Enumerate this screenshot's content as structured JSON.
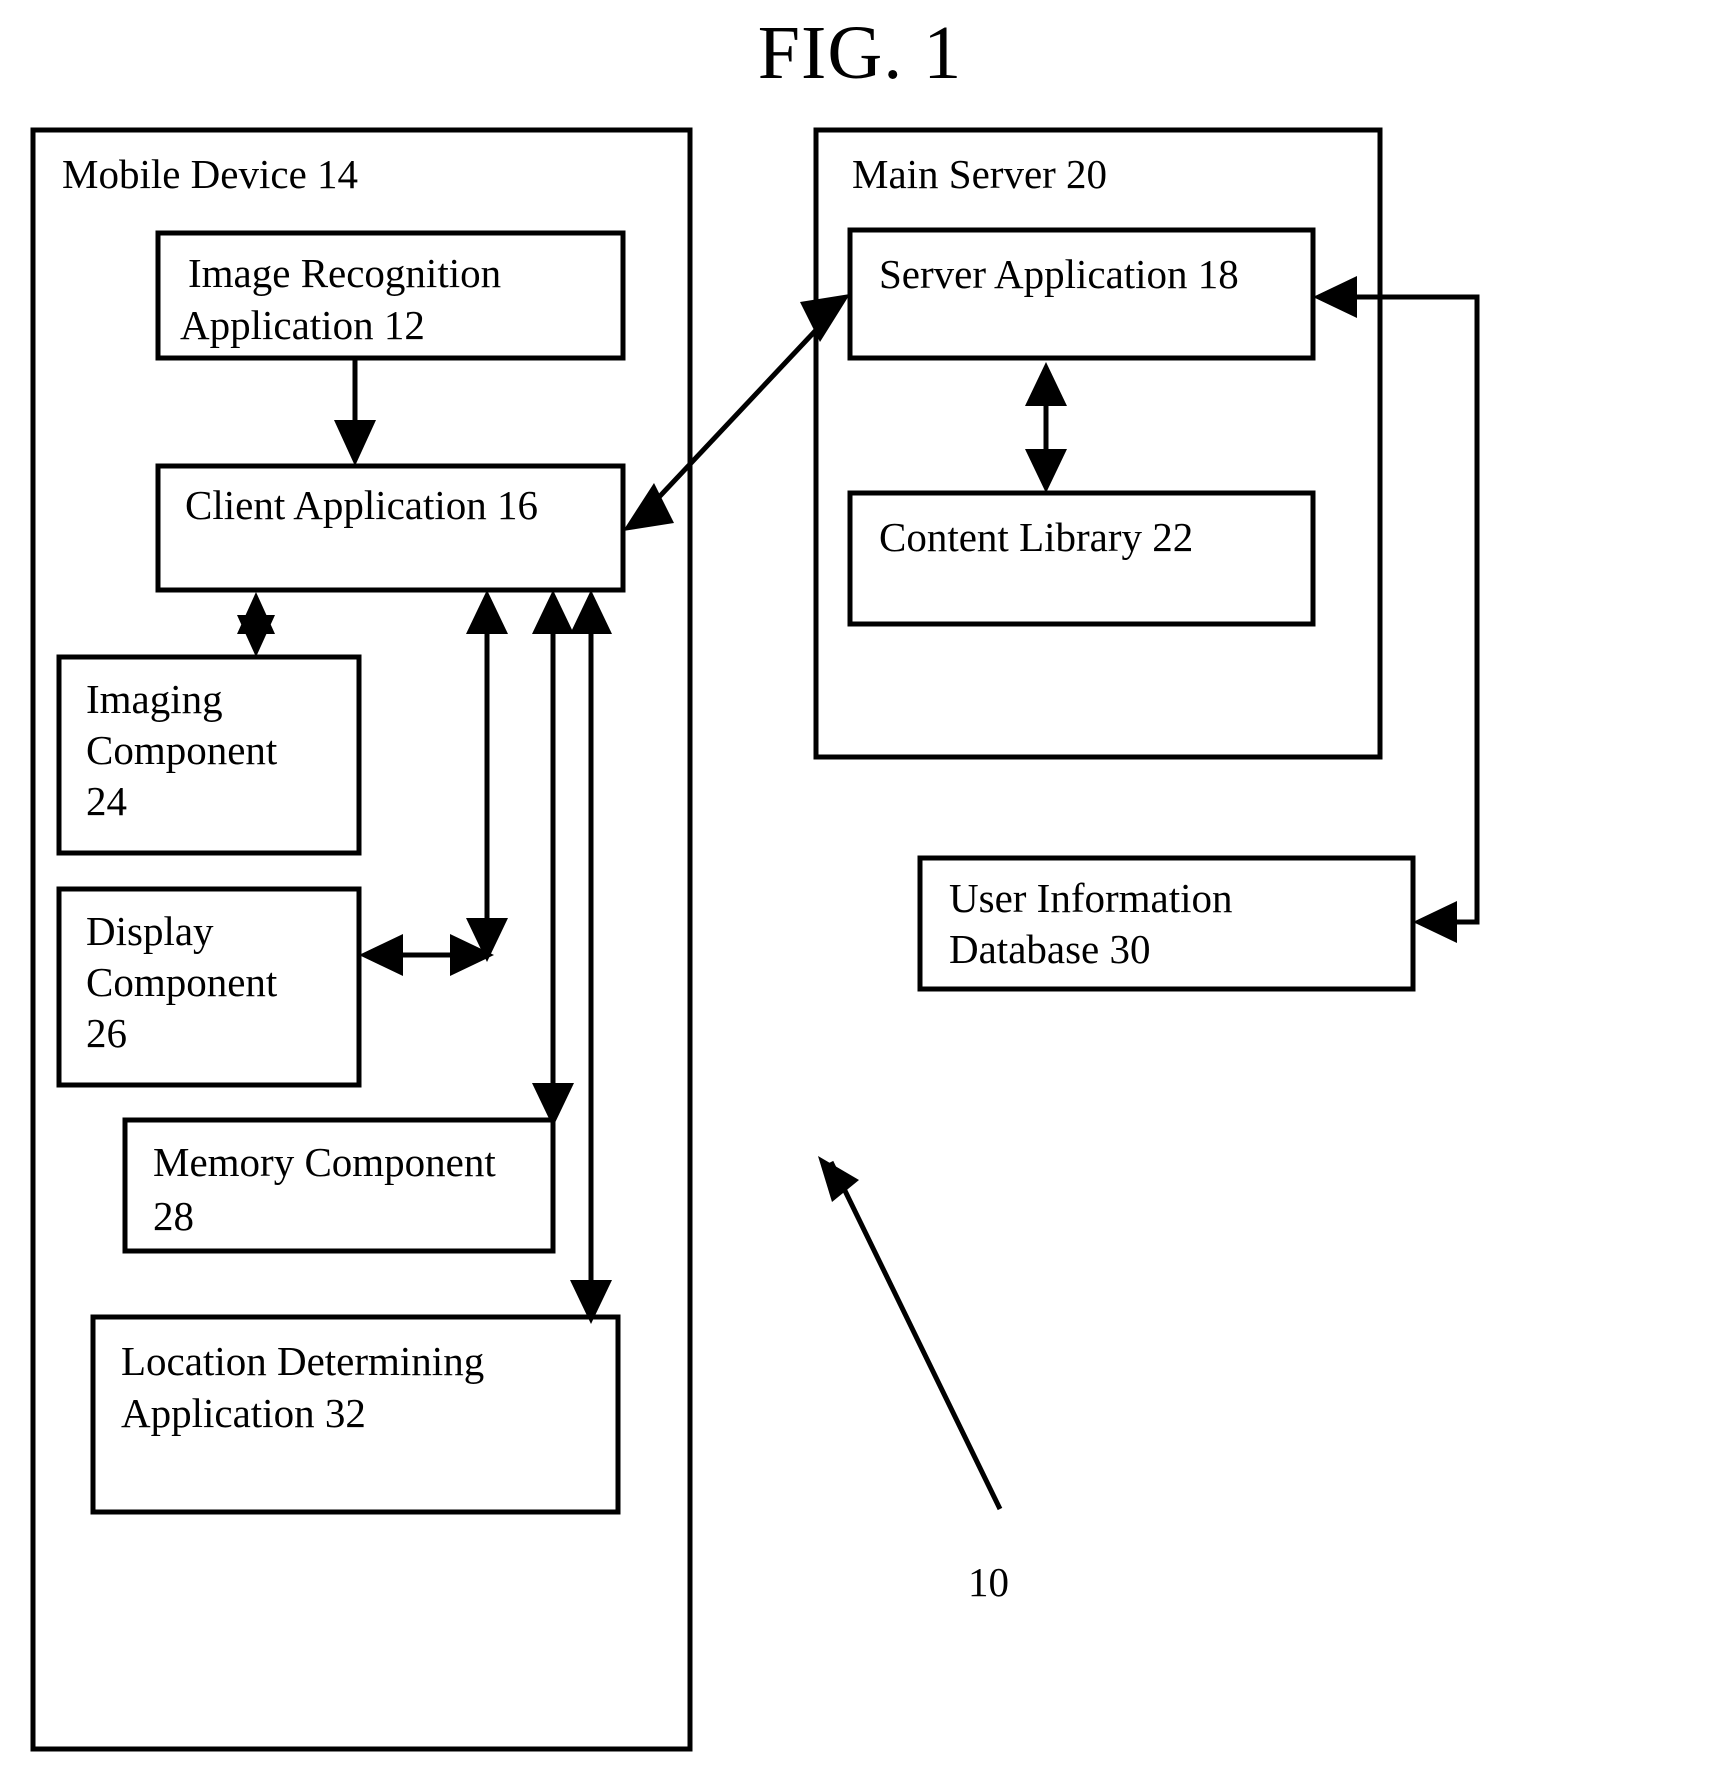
{
  "figure": {
    "title": "FIG. 1",
    "system_reference_numeral": "10"
  },
  "containers": [
    {
      "id": "mobile-device",
      "label": "Mobile Device 14",
      "name": "Mobile Device",
      "numeral": "14"
    },
    {
      "id": "main-server",
      "label": "Main Server 20",
      "name": "Main Server",
      "numeral": "20"
    }
  ],
  "boxes": {
    "image_recognition_application": {
      "line1": "Image Recognition",
      "line2": "Application  12",
      "numeral": "12"
    },
    "client_application": {
      "line1": "Client Application 16",
      "numeral": "16"
    },
    "imaging_component": {
      "line1": "Imaging",
      "line2": "Component",
      "line3": "24",
      "numeral": "24"
    },
    "display_component": {
      "line1": "Display",
      "line2": "Component",
      "line3": "26",
      "numeral": "26"
    },
    "memory_component": {
      "line1": "Memory Component",
      "line2": "28",
      "numeral": "28"
    },
    "location_determining_application": {
      "line1": "Location Determining",
      "line2": "Application 32",
      "numeral": "32"
    },
    "server_application": {
      "line1": "Server Application 18",
      "numeral": "18"
    },
    "content_library": {
      "line1": "Content Library 22",
      "numeral": "22"
    },
    "user_information_database": {
      "line1": "User Information",
      "line2": "Database 30",
      "numeral": "30"
    }
  },
  "colors": {
    "stroke": "#000000",
    "fill": "#ffffff",
    "background": "#ffffff"
  }
}
